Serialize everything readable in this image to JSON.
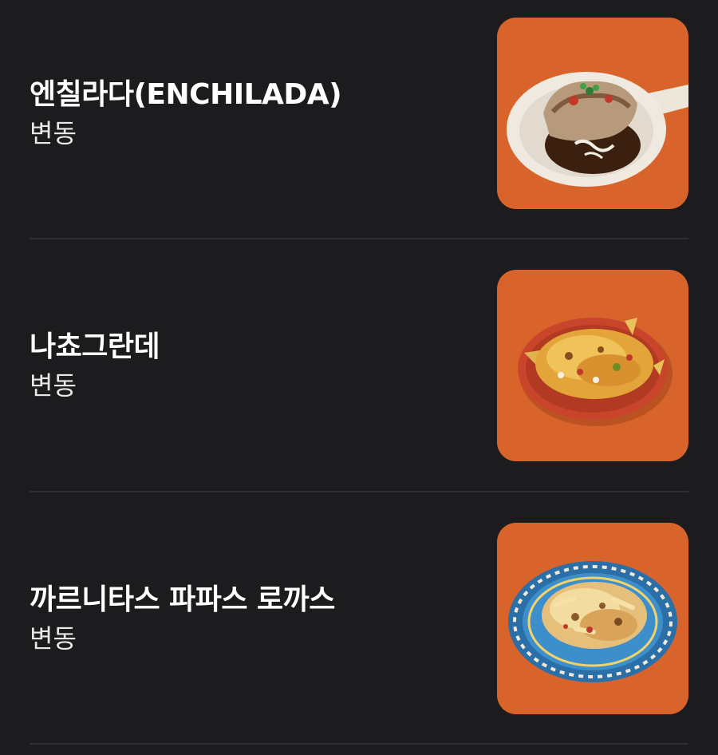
{
  "menu": {
    "items": [
      {
        "name": "엔칠라다(ENCHILADA)",
        "price": "변동",
        "image": "enchilada-plate"
      },
      {
        "name": "나쵸그란데",
        "price": "변동",
        "image": "nachos-plate"
      },
      {
        "name": "까르니타스 파파스 로까스",
        "price": "변동",
        "image": "fries-plate"
      }
    ]
  },
  "colors": {
    "background": "#1c1c1e",
    "thumbnail_bg": "#d9642b",
    "divider": "#2e2e31",
    "text": "#ffffff"
  }
}
